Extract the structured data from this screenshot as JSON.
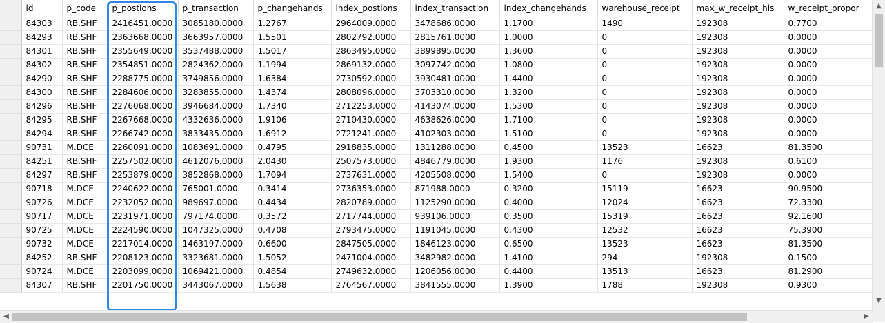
{
  "columns": [
    "id",
    "p_code",
    "p_postions",
    "p_transaction",
    "p_changehands",
    "index_postions",
    "index_transaction",
    "index_changehands",
    "warehouse_receipt",
    "max_w_receipt_his",
    "w_receipt_propor"
  ],
  "rows": [
    [
      "84303",
      "RB.SHF",
      "2416451.0000",
      "3085180.0000",
      "1.2767",
      "2964009.0000",
      "3478686.0000",
      "1.1700",
      "1490",
      "192308",
      "0.7700"
    ],
    [
      "84293",
      "RB.SHF",
      "2363668.0000",
      "3663957.0000",
      "1.5501",
      "2802792.0000",
      "2815761.0000",
      "1.0000",
      "0",
      "192308",
      "0.0000"
    ],
    [
      "84301",
      "RB.SHF",
      "2355649.0000",
      "3537488.0000",
      "1.5017",
      "2863495.0000",
      "3899895.0000",
      "1.3600",
      "0",
      "192308",
      "0.0000"
    ],
    [
      "84302",
      "RB.SHF",
      "2354851.0000",
      "2824362.0000",
      "1.1994",
      "2869132.0000",
      "3097742.0000",
      "1.0800",
      "0",
      "192308",
      "0.0000"
    ],
    [
      "84290",
      "RB.SHF",
      "2288775.0000",
      "3749856.0000",
      "1.6384",
      "2730592.0000",
      "3930481.0000",
      "1.4400",
      "0",
      "192308",
      "0.0000"
    ],
    [
      "84300",
      "RB.SHF",
      "2284606.0000",
      "3283855.0000",
      "1.4374",
      "2808096.0000",
      "3703310.0000",
      "1.3200",
      "0",
      "192308",
      "0.0000"
    ],
    [
      "84296",
      "RB.SHF",
      "2276068.0000",
      "3946684.0000",
      "1.7340",
      "2712253.0000",
      "4143074.0000",
      "1.5300",
      "0",
      "192308",
      "0.0000"
    ],
    [
      "84295",
      "RB.SHF",
      "2267668.0000",
      "4332636.0000",
      "1.9106",
      "2710430.0000",
      "4638626.0000",
      "1.7100",
      "0",
      "192308",
      "0.0000"
    ],
    [
      "84294",
      "RB.SHF",
      "2266742.0000",
      "3833435.0000",
      "1.6912",
      "2721241.0000",
      "4102303.0000",
      "1.5100",
      "0",
      "192308",
      "0.0000"
    ],
    [
      "90731",
      "M.DCE",
      "2260091.0000",
      "1083691.0000",
      "0.4795",
      "2918835.0000",
      "1311288.0000",
      "0.4500",
      "13523",
      "16623",
      "81.3500"
    ],
    [
      "84251",
      "RB.SHF",
      "2257502.0000",
      "4612076.0000",
      "2.0430",
      "2507573.0000",
      "4846779.0000",
      "1.9300",
      "1176",
      "192308",
      "0.6100"
    ],
    [
      "84297",
      "RB.SHF",
      "2253879.0000",
      "3852868.0000",
      "1.7094",
      "2737631.0000",
      "4205508.0000",
      "1.5400",
      "0",
      "192308",
      "0.0000"
    ],
    [
      "90718",
      "M.DCE",
      "2240622.0000",
      "765001.0000",
      "0.3414",
      "2736353.0000",
      "871988.0000",
      "0.3200",
      "15119",
      "16623",
      "90.9500"
    ],
    [
      "90726",
      "M.DCE",
      "2232052.0000",
      "989697.0000",
      "0.4434",
      "2820789.0000",
      "1125290.0000",
      "0.4000",
      "12024",
      "16623",
      "72.3300"
    ],
    [
      "90717",
      "M.DCE",
      "2231971.0000",
      "797174.0000",
      "0.3572",
      "2717744.0000",
      "939106.0000",
      "0.3500",
      "15319",
      "16623",
      "92.1600"
    ],
    [
      "90725",
      "M.DCE",
      "2224590.0000",
      "1047325.0000",
      "0.4708",
      "2793475.0000",
      "1191045.0000",
      "0.4300",
      "12532",
      "16623",
      "75.3900"
    ],
    [
      "90732",
      "M.DCE",
      "2217014.0000",
      "1463197.0000",
      "0.6600",
      "2847505.0000",
      "1846123.0000",
      "0.6500",
      "13523",
      "16623",
      "81.3500"
    ],
    [
      "84252",
      "RB.SHF",
      "2208123.0000",
      "3323681.0000",
      "1.5052",
      "2471004.0000",
      "3482982.0000",
      "1.4100",
      "294",
      "192308",
      "0.1500"
    ],
    [
      "90724",
      "M.DCE",
      "2203099.0000",
      "1069421.0000",
      "0.4854",
      "2749632.0000",
      "1206056.0000",
      "0.4400",
      "13513",
      "16623",
      "81.2900"
    ],
    [
      "84307",
      "RB.SHF",
      "2201750.0000",
      "3443067.0000",
      "1.5638",
      "2764567.0000",
      "3841555.0000",
      "1.3900",
      "1788",
      "192308",
      "0.9300"
    ]
  ],
  "highlight_color": "#2f86e5",
  "icons": {
    "up": "chevron-up-icon",
    "down": "chevron-down-icon",
    "left": "chevron-left-icon",
    "right": "chevron-right-icon"
  }
}
